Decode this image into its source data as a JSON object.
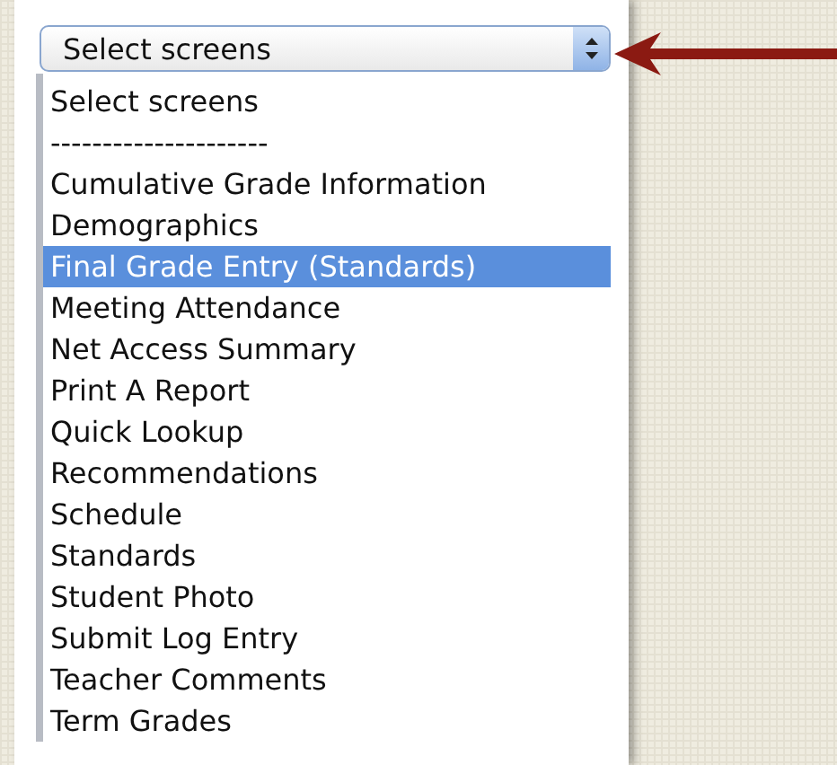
{
  "select": {
    "value": "Select screens"
  },
  "options": [
    {
      "label": "Select screens",
      "selected": false
    },
    {
      "label": "---------------------",
      "selected": false
    },
    {
      "label": "Cumulative Grade Information",
      "selected": false
    },
    {
      "label": "Demographics",
      "selected": false
    },
    {
      "label": "Final Grade Entry (Standards)",
      "selected": true
    },
    {
      "label": "Meeting Attendance",
      "selected": false
    },
    {
      "label": "Net Access Summary",
      "selected": false
    },
    {
      "label": "Print A Report",
      "selected": false
    },
    {
      "label": "Quick Lookup",
      "selected": false
    },
    {
      "label": "Recommendations",
      "selected": false
    },
    {
      "label": "Schedule",
      "selected": false
    },
    {
      "label": "Standards",
      "selected": false
    },
    {
      "label": "Student Photo",
      "selected": false
    },
    {
      "label": "Submit Log Entry",
      "selected": false
    },
    {
      "label": "Teacher Comments",
      "selected": false
    },
    {
      "label": "Term Grades",
      "selected": false
    }
  ]
}
